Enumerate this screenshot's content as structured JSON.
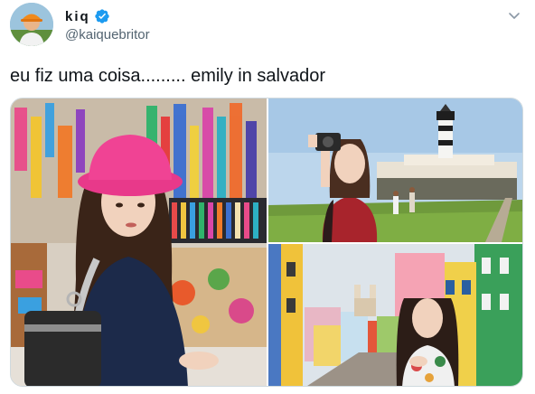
{
  "author": {
    "display_name": "kiq",
    "handle": "@kaiquebritor",
    "verified": true,
    "avatar_icon": "profile-avatar",
    "accent_color": "#1d9bf0"
  },
  "tweet": {
    "text": "eu fiz uma coisa......... emily in salvador"
  },
  "media": [
    {
      "id": "market",
      "icon": "photo-market-pink-hat"
    },
    {
      "id": "lighthouse",
      "icon": "photo-lighthouse-selfie"
    },
    {
      "id": "pelourinho",
      "icon": "photo-colorful-street"
    }
  ],
  "colors": {
    "text": "#0f1419",
    "secondary_text": "#536471",
    "verified": "#1d9bf0",
    "border": "#cfd9de"
  }
}
